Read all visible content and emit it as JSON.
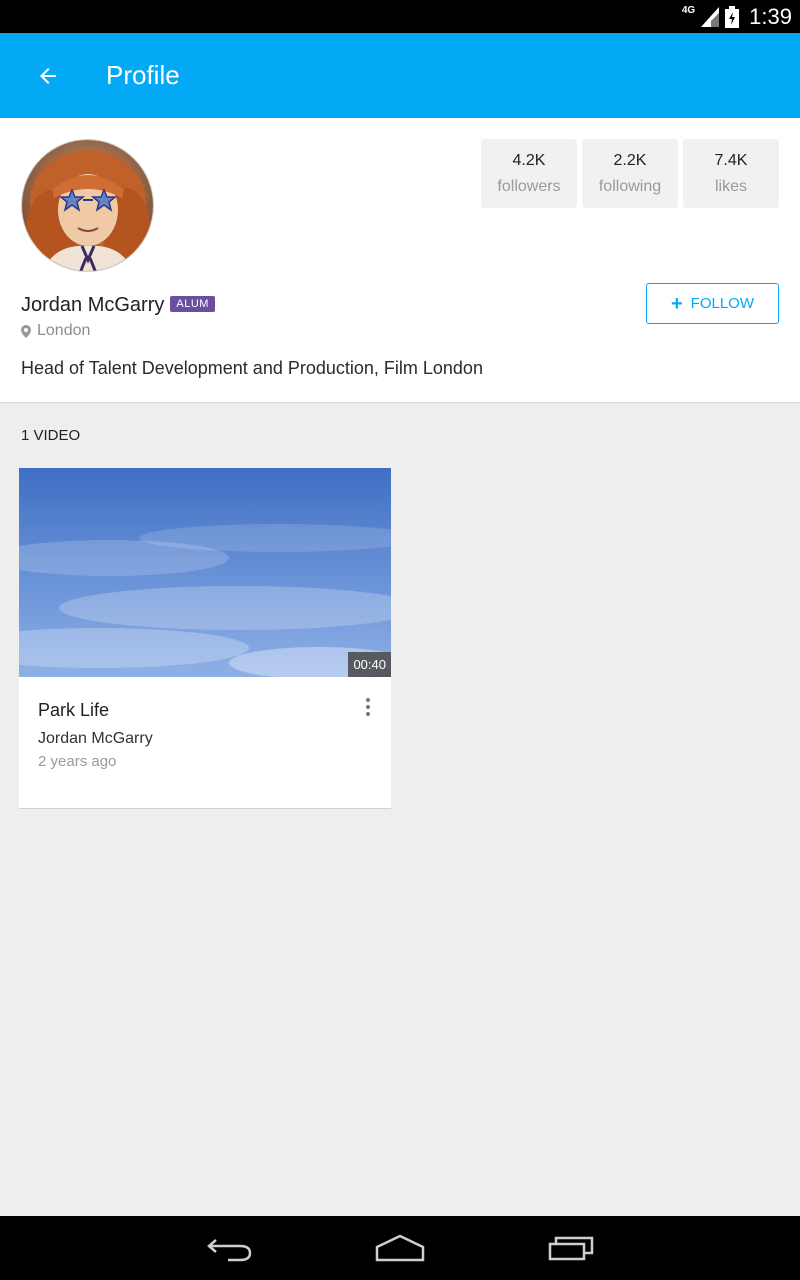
{
  "status_bar": {
    "network": "4G",
    "time": "1:39"
  },
  "app_bar": {
    "title": "Profile",
    "back_icon": "arrow-back-icon"
  },
  "profile": {
    "name": "Jordan McGarry",
    "badge": "ALUM",
    "location": "London",
    "bio": "Head of Talent Development and Production, Film London",
    "stats": [
      {
        "value": "4.2K",
        "label": "followers"
      },
      {
        "value": "2.2K",
        "label": "following"
      },
      {
        "value": "7.4K",
        "label": "likes"
      }
    ],
    "follow_label": "FOLLOW"
  },
  "videos": {
    "heading": "1 VIDEO",
    "items": [
      {
        "title": "Park Life",
        "author": "Jordan McGarry",
        "age": "2 years ago",
        "duration": "00:40"
      }
    ]
  },
  "colors": {
    "accent": "#03a9f4",
    "badge": "#6a4fa1"
  }
}
